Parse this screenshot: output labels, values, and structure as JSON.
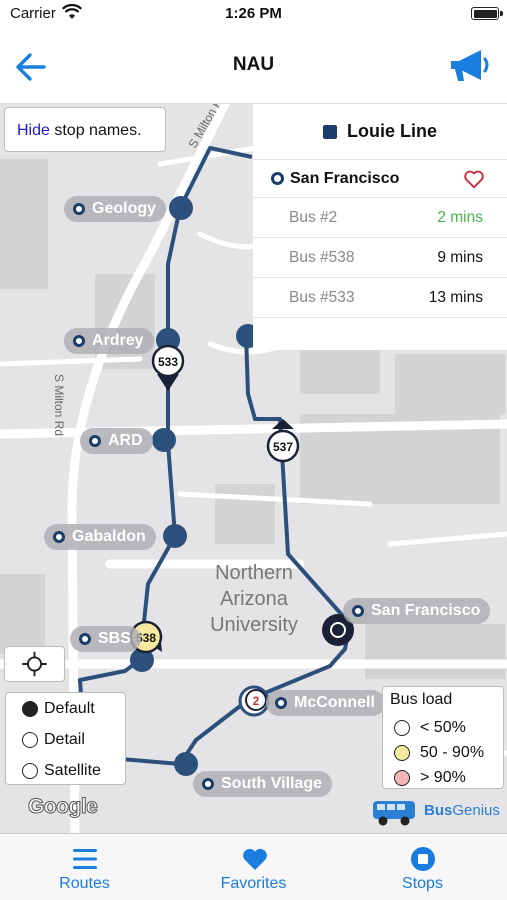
{
  "status": {
    "carrier": "Carrier",
    "time": "1:26 PM"
  },
  "nav": {
    "title": "NAU"
  },
  "map": {
    "hide_button": {
      "keyword": "Hide",
      "rest": " stop names."
    },
    "streets": [
      "S Milton Rd",
      "S Milton R"
    ],
    "campus_label": [
      "Northern",
      "Arizona",
      "University"
    ],
    "stops": {
      "geology": "Geology",
      "ardrey": "Ardrey",
      "ard": "ARD",
      "gabaldon": "Gabaldon",
      "sbs": "SBS",
      "san_francisco": "San Francisco",
      "mcconnell": "McConnell",
      "south_village": "South Village"
    },
    "buses": [
      "533",
      "537",
      "538",
      "2"
    ],
    "panel": {
      "line_name": "Louie Line",
      "line_color": "#1b3d6b",
      "stop_name": "San Francisco",
      "arrivals": [
        {
          "bus": "Bus #2",
          "eta": "2 mins"
        },
        {
          "bus": "Bus #538",
          "eta": "9 mins"
        },
        {
          "bus": "Bus #533",
          "eta": "13 mins"
        }
      ]
    },
    "map_types": {
      "options": [
        "Default",
        "Detail",
        "Satellite"
      ],
      "selected": "Default"
    },
    "bus_load": {
      "title": "Bus load",
      "levels": [
        {
          "label": "< 50%",
          "color": "#ffffff"
        },
        {
          "label": "50 - 90%",
          "color": "#f6e9a0"
        },
        {
          "label": "> 90%",
          "color": "#f2b6b6"
        }
      ]
    },
    "attribution": "Google",
    "brand": {
      "bold": "Bus",
      "rest": "Genius"
    }
  },
  "tabs": [
    {
      "label": "Routes",
      "icon": "list-icon"
    },
    {
      "label": "Favorites",
      "icon": "heart-icon"
    },
    {
      "label": "Stops",
      "icon": "stop-icon"
    }
  ],
  "colors": {
    "accent": "#1a7ee0",
    "route": "#2d4f7c",
    "soon": "#4caf50"
  }
}
